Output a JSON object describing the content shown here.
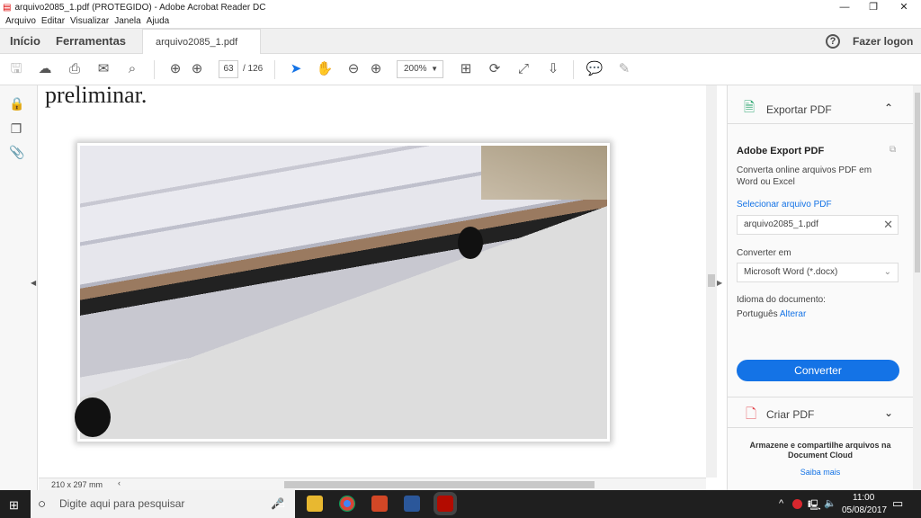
{
  "window": {
    "title": "arquivo2085_1.pdf (PROTEGIDO) - Adobe Acrobat Reader DC"
  },
  "menu": [
    "Arquivo",
    "Editar",
    "Visualizar",
    "Janela",
    "Ajuda"
  ],
  "tabs": {
    "home": "Início",
    "tools": "Ferramentas",
    "doc": "arquivo2085_1.pdf ...",
    "help": "?",
    "login": "Fazer logon"
  },
  "toolbar": {
    "page_current": "63",
    "page_total": "/ 126",
    "zoom": "200%"
  },
  "document": {
    "heading": "preliminar.",
    "page_size": "210 x 297 mm"
  },
  "panel": {
    "export_title": "Exportar PDF",
    "service": "Adobe Export PDF",
    "desc1": "Converta online arquivos PDF em",
    "desc2": "Word ou Excel",
    "select_link": "Selecionar arquivo PDF",
    "file": "arquivo2085_1.pdf",
    "convert_label": "Converter em",
    "format": "Microsoft Word (*.docx)",
    "lang_label": "Idioma do documento:",
    "lang": "Português",
    "change": "Alterar",
    "convert_btn": "Converter",
    "create_title": "Criar PDF",
    "cloud1": "Armazene e compartilhe arquivos na",
    "cloud2": "Document Cloud",
    "more": "Saiba mais"
  },
  "taskbar": {
    "search_placeholder": "Digite aqui para pesquisar",
    "time": "11:00",
    "date": "05/08/2017"
  },
  "colors": {
    "accent": "#1473e6",
    "export_icon": "#2da771",
    "create_icon": "#e34850"
  }
}
